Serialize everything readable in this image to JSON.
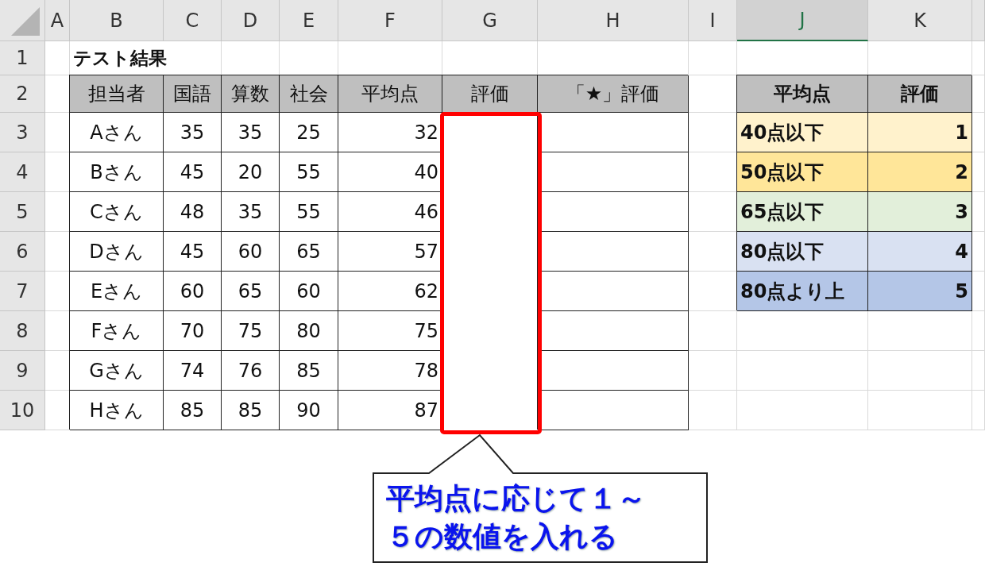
{
  "column_headers": [
    {
      "label": "A",
      "selected": false
    },
    {
      "label": "B",
      "selected": false
    },
    {
      "label": "C",
      "selected": false
    },
    {
      "label": "D",
      "selected": false
    },
    {
      "label": "E",
      "selected": false
    },
    {
      "label": "F",
      "selected": false
    },
    {
      "label": "G",
      "selected": false
    },
    {
      "label": "H",
      "selected": false
    },
    {
      "label": "I",
      "selected": false
    },
    {
      "label": "J",
      "selected": true
    },
    {
      "label": "K",
      "selected": false
    }
  ],
  "row_headers": [
    "1",
    "2",
    "3",
    "4",
    "5",
    "6",
    "7",
    "8",
    "9",
    "10"
  ],
  "title": "テスト結果",
  "main_table": {
    "columns": [
      "担当者",
      "国語",
      "算数",
      "社会",
      "平均点",
      "評価",
      "「★」評価"
    ],
    "rows": [
      [
        "Aさん",
        "35",
        "35",
        "25",
        "32"
      ],
      [
        "Bさん",
        "45",
        "20",
        "55",
        "40"
      ],
      [
        "Cさん",
        "48",
        "35",
        "55",
        "46"
      ],
      [
        "Dさん",
        "45",
        "60",
        "65",
        "57"
      ],
      [
        "Eさん",
        "60",
        "65",
        "60",
        "62"
      ],
      [
        "Fさん",
        "70",
        "75",
        "80",
        "75"
      ],
      [
        "Gさん",
        "74",
        "76",
        "85",
        "78"
      ],
      [
        "Hさん",
        "85",
        "85",
        "90",
        "87"
      ]
    ]
  },
  "lookup_table": {
    "columns": [
      "平均点",
      "評価"
    ],
    "rows": [
      {
        "range": "40点以下",
        "grade": "1",
        "color": "#fff2cc"
      },
      {
        "range": "50点以下",
        "grade": "2",
        "color": "#ffe699"
      },
      {
        "range": "65点以下",
        "grade": "3",
        "color": "#e2efda"
      },
      {
        "range": "80点以下",
        "grade": "4",
        "color": "#d9e1f2"
      },
      {
        "range": "80点より上",
        "grade": "5",
        "color": "#b4c6e7"
      }
    ]
  },
  "callout": {
    "text": "平均点に応じて１～５の数値を入れる"
  }
}
